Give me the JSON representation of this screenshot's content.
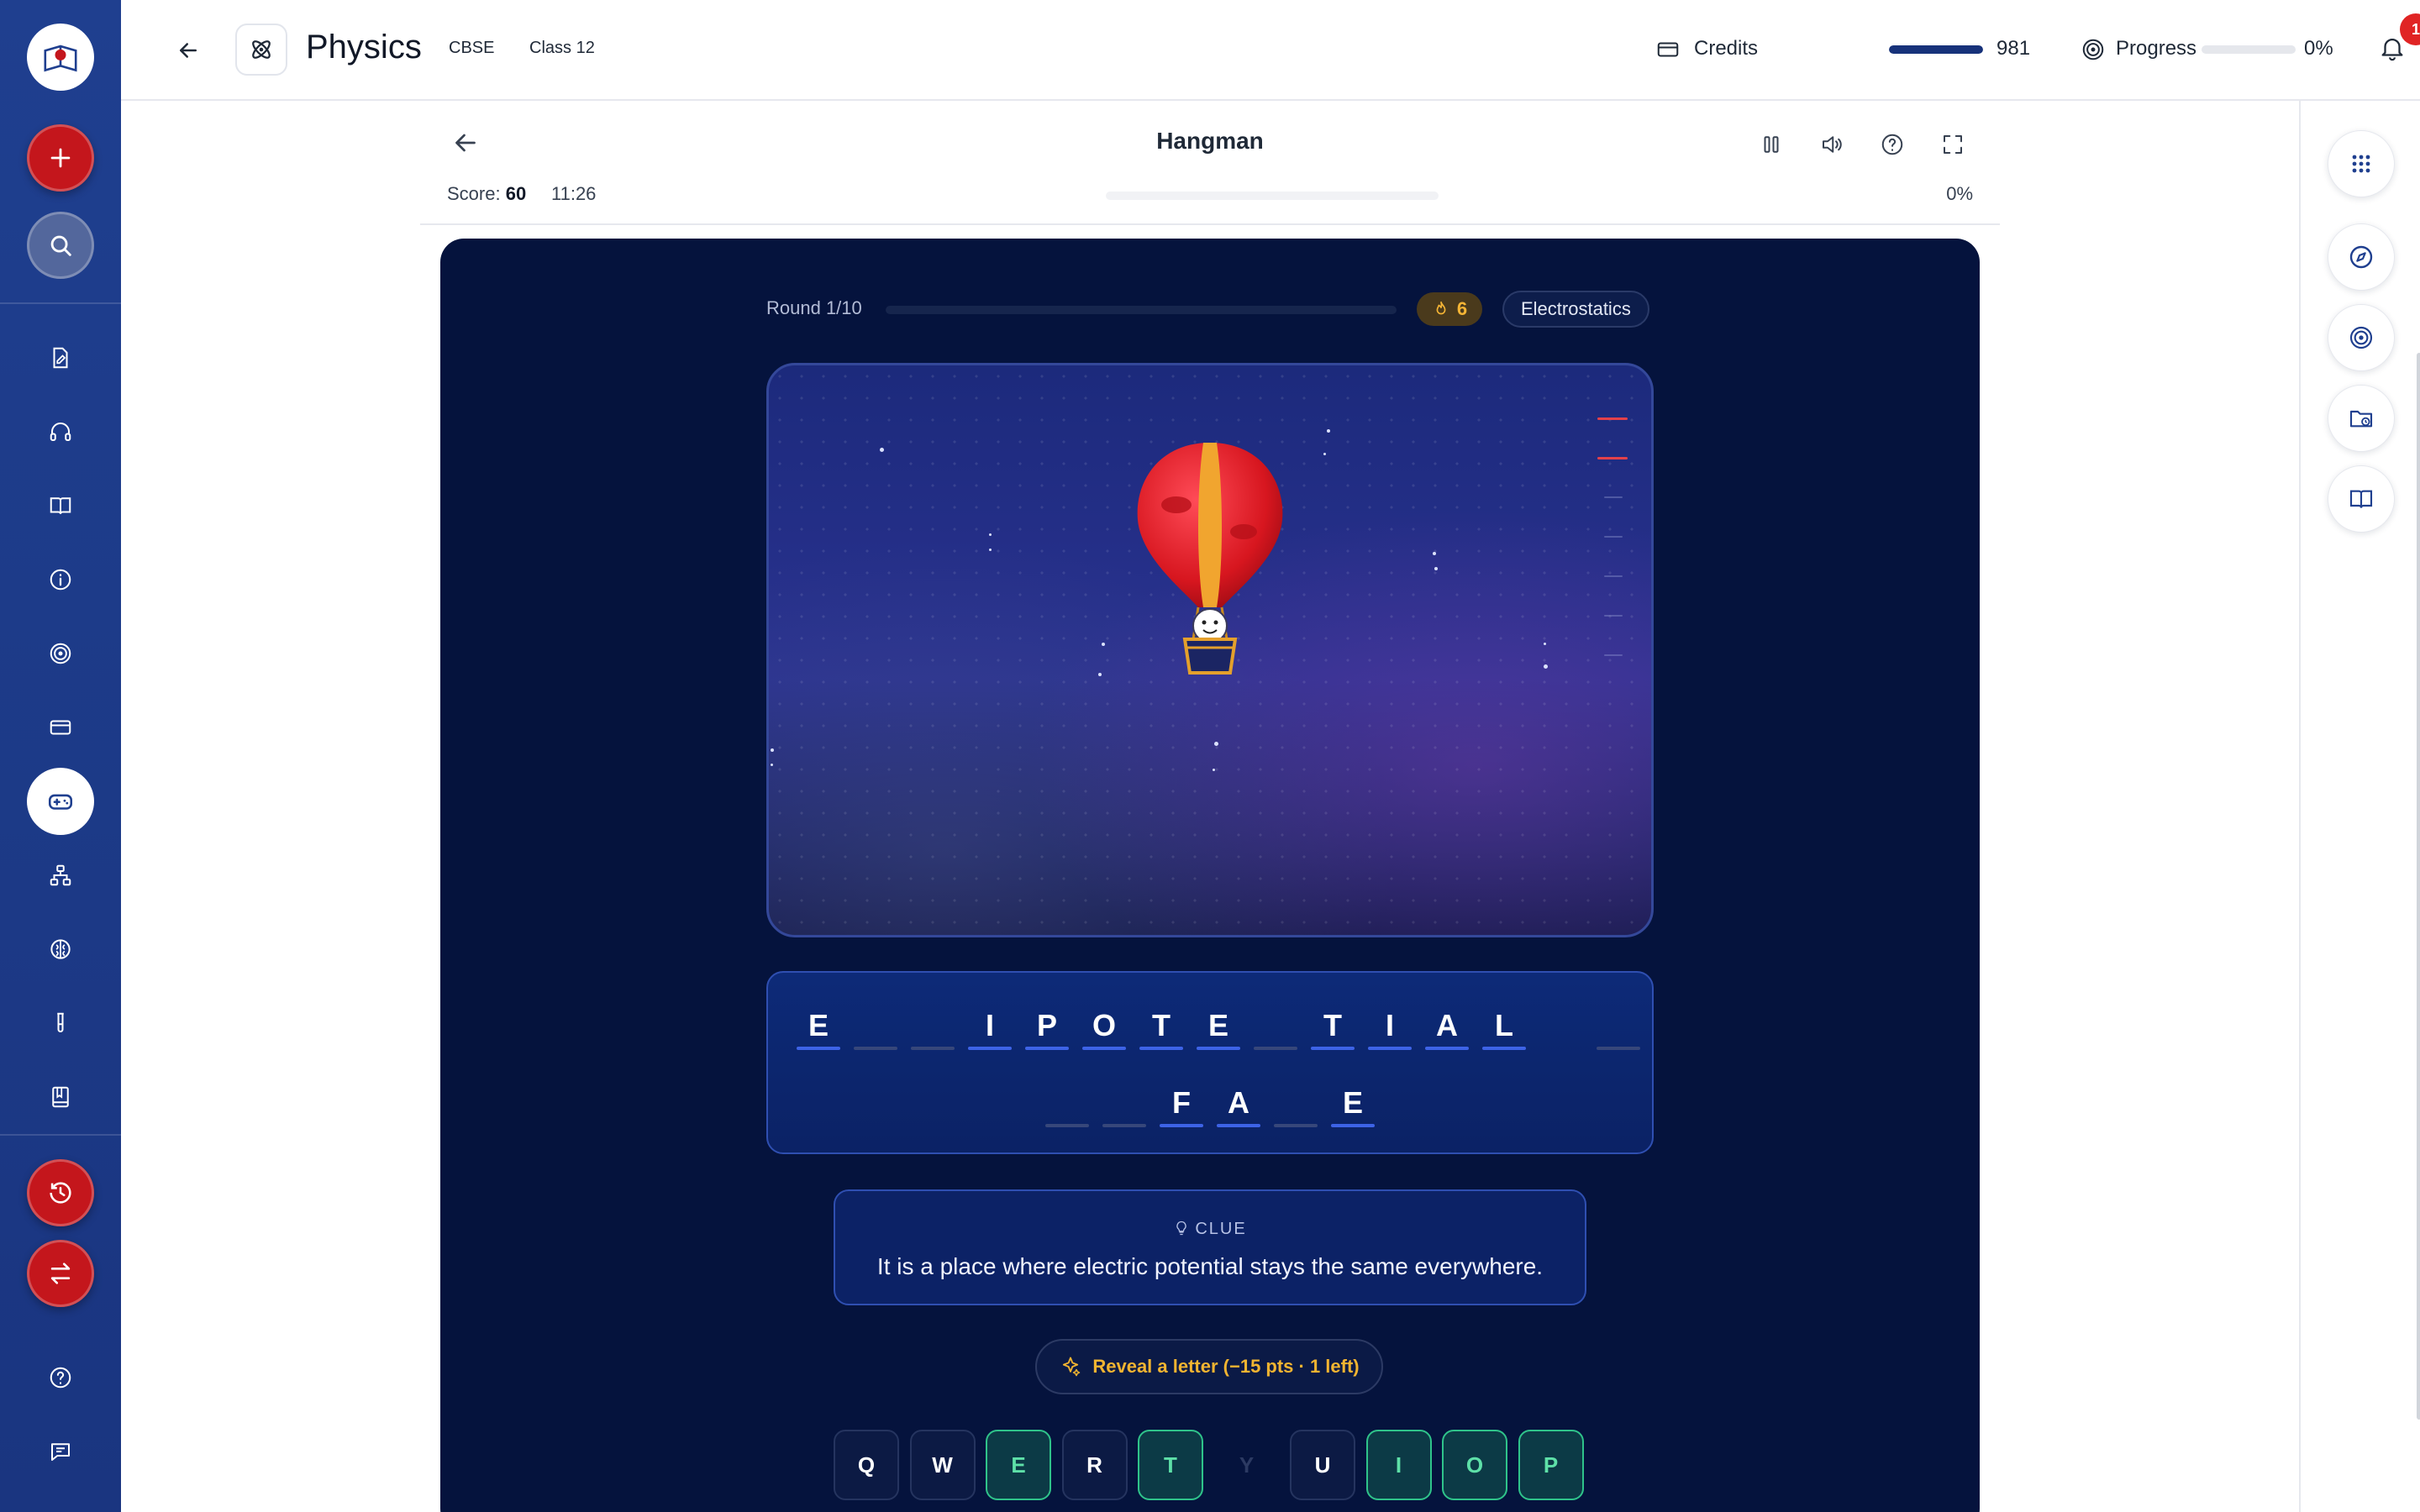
{
  "header": {
    "subject": "Physics",
    "board": "CBSE",
    "class_label": "Class 12",
    "credits_label": "Credits",
    "credits_value": "981",
    "credits_fraction": 1.0,
    "progress_label": "Progress",
    "progress_value": "0%",
    "progress_fraction": 0.0,
    "notification_count": "1"
  },
  "sidebar": {
    "top_actions": [
      "plus-icon",
      "search-icon"
    ],
    "nav_icons": [
      "notes-icon",
      "headphones-icon",
      "book-icon",
      "info-icon",
      "target-icon",
      "card-icon",
      "gamepad-icon",
      "hierarchy-icon",
      "brain-icon",
      "test-tube-icon",
      "notebook-icon"
    ],
    "active_item": "gamepad-icon",
    "bottom_actions": [
      "history-icon",
      "swap-icon"
    ],
    "footer_icons": [
      "help-icon",
      "chat-icon"
    ]
  },
  "right_rail": {
    "icons": [
      "apps-grid-icon",
      "compass-icon",
      "target-icon",
      "folder-clock-icon",
      "book-open-icon"
    ]
  },
  "game": {
    "title": "Hangman",
    "score_label": "Score:",
    "score_value": "60",
    "timer": "11:26",
    "percent": "0%",
    "round_label": "Round 1/10",
    "round_fraction": 0.0,
    "streak": "6",
    "topic": "Electrostatics",
    "lives_remaining": 2,
    "lives_total": 7,
    "word_rows": [
      [
        "E",
        "",
        "",
        "I",
        "P",
        "O",
        "T",
        "E",
        "",
        "T",
        "I",
        "A",
        "L",
        " ",
        ""
      ],
      [
        "",
        "",
        "F",
        "A",
        "",
        "E"
      ]
    ],
    "clue_heading": "CLUE",
    "clue_text": "It is a place where electric potential stays the same everywhere.",
    "reveal_label": "Reveal a letter (−15 pts · 1 left)",
    "keyboard": [
      {
        "key": "Q",
        "state": "unused"
      },
      {
        "key": "W",
        "state": "unused"
      },
      {
        "key": "E",
        "state": "hit"
      },
      {
        "key": "R",
        "state": "unused"
      },
      {
        "key": "T",
        "state": "hit"
      },
      {
        "key": "Y",
        "state": "used"
      },
      {
        "key": "U",
        "state": "unused"
      },
      {
        "key": "I",
        "state": "hit"
      },
      {
        "key": "O",
        "state": "hit"
      },
      {
        "key": "P",
        "state": "hit"
      }
    ],
    "colors": {
      "accent_red": "#c4161c",
      "sidebar_blue": "#1f3f8f",
      "panel_navy": "#05133d",
      "hit_green": "#2fc38a",
      "reveal_gold": "#f2b431"
    }
  }
}
